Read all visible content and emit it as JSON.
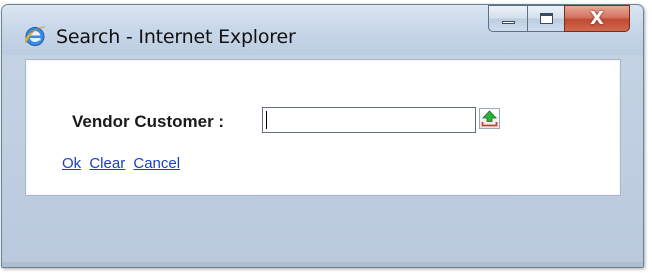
{
  "window": {
    "title": "Search - Internet Explorer",
    "app_icon": "internet-explorer-icon",
    "caption_buttons": {
      "minimize_icon": "minimize-icon",
      "maximize_icon": "maximize-icon",
      "close_icon": "close-icon",
      "close_glyph": "X"
    },
    "colors": {
      "title_bar": "#c9d8e9",
      "close_button": "#c85a40",
      "link": "#1a3fc2"
    }
  },
  "form": {
    "vendor_customer_label": "Vendor Customer :",
    "vendor_customer_value": "",
    "lookup_icon": "lookup-arrow-icon"
  },
  "actions": {
    "ok_label": "Ok",
    "clear_label": "Clear",
    "cancel_label": "Cancel"
  }
}
